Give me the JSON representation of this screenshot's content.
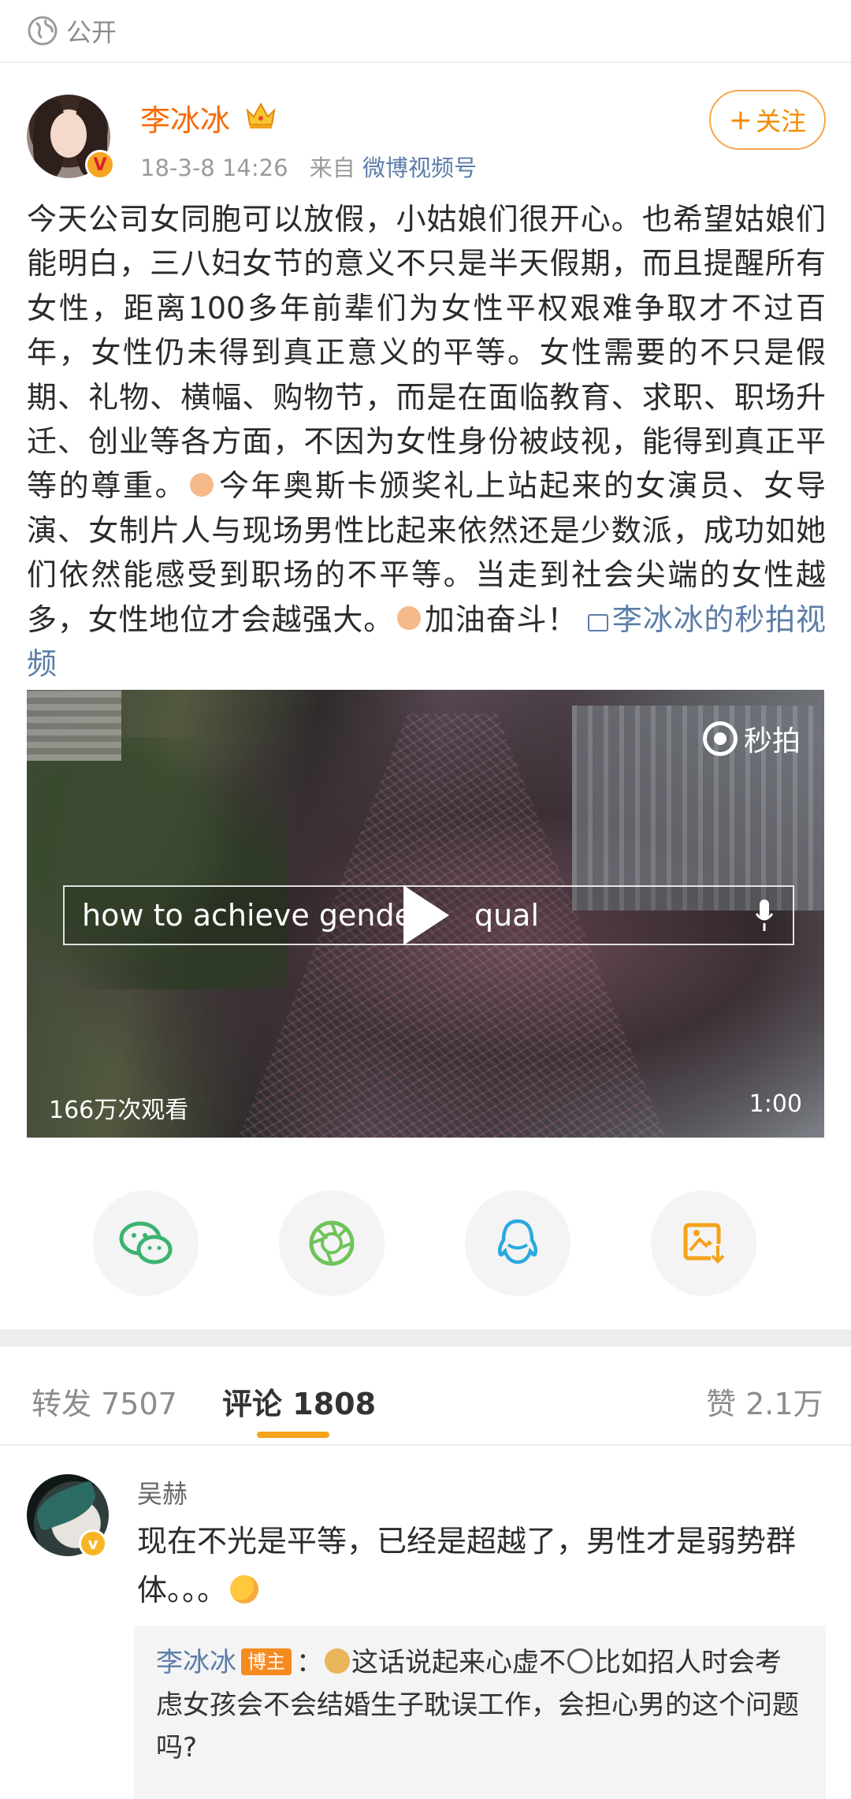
{
  "visibility": {
    "label": "公开",
    "icon": "globe-icon"
  },
  "author": {
    "name": "李冰冰",
    "date": "18-3-8 14:26",
    "source_prefix": "来自",
    "source": "微博视频号",
    "follow_label": "关注",
    "verified_badge": "V"
  },
  "post": {
    "body": "今天公司女同胞可以放假，小姑娘们很开心。也希望姑娘们能明白，三八妇女节的意义不只是半天假期，而且提醒所有女性，距离100多年前辈们为女性平权艰难争取才不过百年，女性仍未得到真正意义的平等。女性需要的不只是假期、礼物、横幅、购物节，而是在面临教育、求职、职场升迁、创业等各方面，不因为女性身份被歧视，能得到真正平等的尊重。",
    "body2": "今年奥斯卡颁奖礼上站起来的女演员、女导演、女制片人与现场男性比起来依然还是少数派，成功如她们依然能感受到职场的不平等。当走到社会尖端的女性越多，女性地位才会越强大。",
    "body3": "加油奋斗！",
    "video_link": "李冰冰的秒拍视频"
  },
  "video": {
    "brand": "秒拍",
    "search_text": "how to achieve gende",
    "search_text_tail": "qual",
    "views": "166万次观看",
    "duration": "1:00"
  },
  "share": [
    "wechat-icon",
    "moments-icon",
    "qq-icon",
    "save-image-icon"
  ],
  "tabs": {
    "repost_label": "转发",
    "repost_count": "7507",
    "comment_label": "评论",
    "comment_count": "1808",
    "like_label": "赞",
    "like_count": "2.1万"
  },
  "comment": {
    "name": "吴赫",
    "text": "现在不光是平等，已经是超越了，男性才是弱势群体。。。",
    "reply": {
      "name": "李冰冰",
      "tag": "博主",
      "colon": "：",
      "part1": "这话说起来心虚不",
      "part2": "比如招人时会考虑女孩会不会结婚生子耽误工作，会担心男的这个问题吗?"
    }
  },
  "colors": {
    "accent": "#f58a00",
    "name_orange": "#f86a00",
    "link_blue": "#5c7da8",
    "tab_underline": "#f5a21b"
  }
}
